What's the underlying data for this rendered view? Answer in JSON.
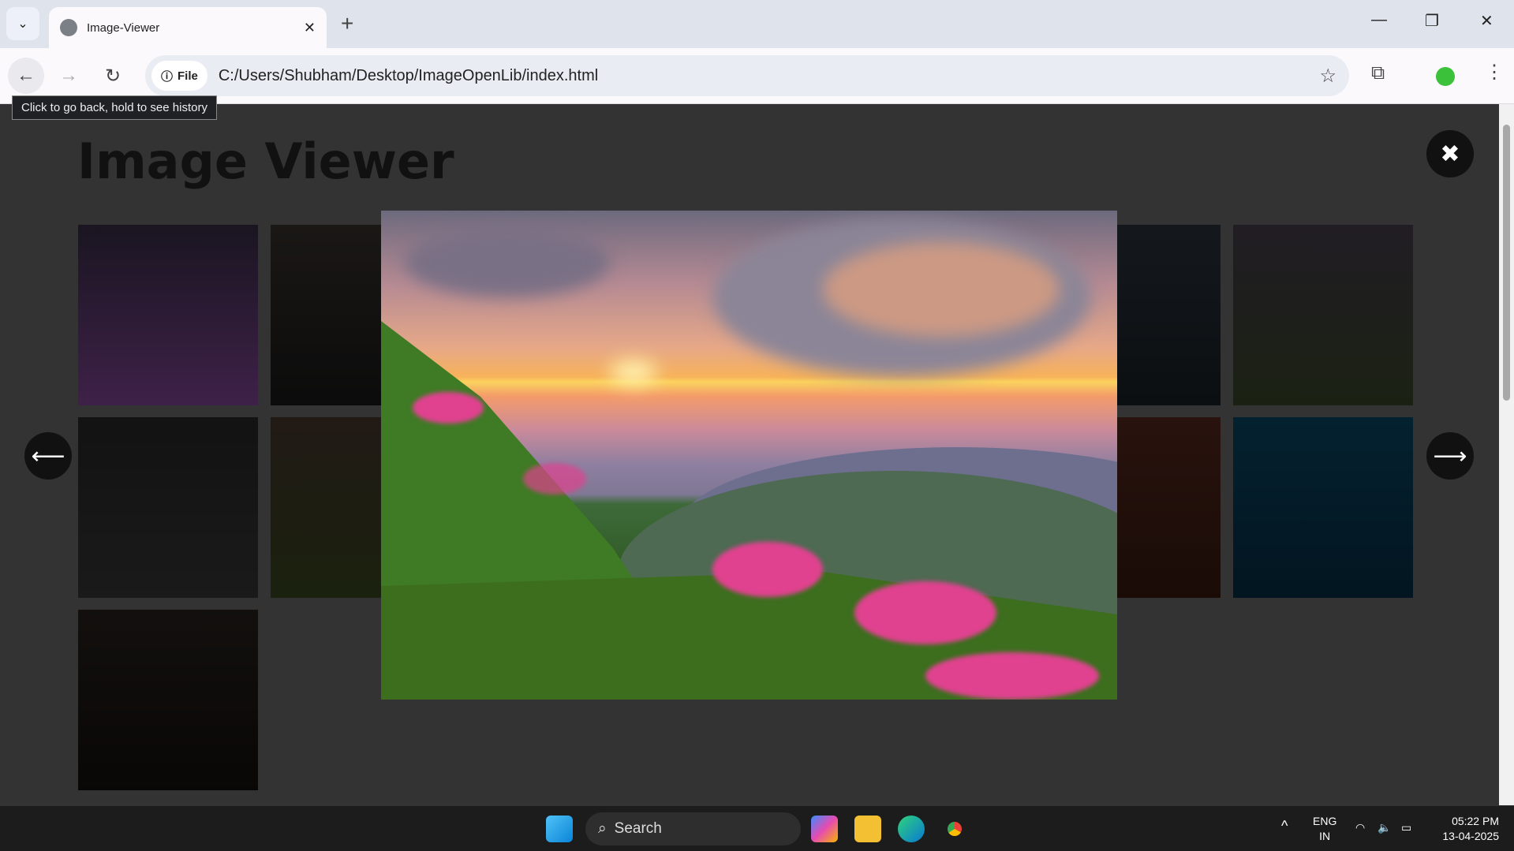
{
  "browser": {
    "tab_title": "Image-Viewer",
    "address": "C:/Users/Shubham/Desktop/ImageOpenLib/index.html",
    "file_chip": "File",
    "tooltip": "Click to go back, hold to see history",
    "profile_color": "#3cc13b"
  },
  "page": {
    "title": "Image Viewer",
    "close_icon": "✖",
    "prev_icon": "⟵",
    "next_icon": "⟶",
    "thumbnails": [
      "sunset-flowers",
      "woman-portrait",
      "landscape",
      "landscape",
      "landscape",
      "lake",
      "mountains",
      "screenshot-dialog",
      "meadow",
      "",
      "",
      "",
      "dark-red",
      "blue-abstract",
      "old-man-portrait"
    ]
  },
  "taskbar": {
    "search": "Search",
    "lang1": "ENG",
    "lang2": "IN",
    "time": "05:22 PM",
    "date": "13-04-2025"
  }
}
